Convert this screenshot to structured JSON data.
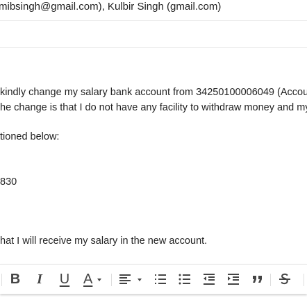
{
  "recipients": {
    "text": "mibsingh@gmail.com), Kulbir Singh (gmail.com)"
  },
  "body": {
    "lines": [
      "kindly change my salary bank account from 34250100006049 (Accou",
      "he change is that I do not have any facility to withdraw money and my",
      "tioned below:",
      "830",
      "hat I will receive my salary in the new account."
    ]
  },
  "toolbar": {
    "icons": [
      "bold-icon",
      "italic-icon",
      "underline-icon",
      "text-color-icon",
      "align-icon",
      "numbered-list-icon",
      "bulleted-list-icon",
      "indent-less-icon",
      "indent-more-icon",
      "quote-icon",
      "strikethrough-icon"
    ],
    "bold_glyph": "B",
    "italic_glyph": "I",
    "underline_glyph": "U",
    "text_color_glyph": "A"
  }
}
